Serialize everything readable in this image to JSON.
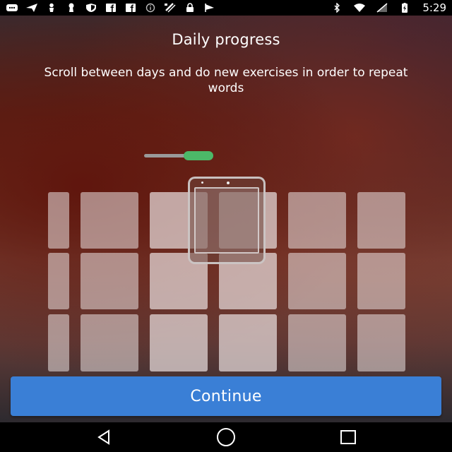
{
  "status_bar": {
    "time": "5:29",
    "left_icons": [
      "message-icon",
      "send-icon",
      "person-icon",
      "keyhole-icon",
      "shield-icon",
      "facebook-icon",
      "facebook-icon",
      "info-icon",
      "satellite-icon",
      "lock-icon",
      "flag-icon"
    ],
    "right_icons": [
      "bluetooth-icon",
      "wifi-icon",
      "signal-icon",
      "battery-charging-icon"
    ]
  },
  "onboarding": {
    "title": "Daily progress",
    "subtitle": "Scroll between days and do new exercises in order to repeat words",
    "continue_label": "Continue"
  },
  "colors": {
    "accent_button": "#3a7fd6",
    "slider_knob": "#4cb868"
  },
  "nav_bar": {
    "buttons": [
      "back-icon",
      "home-icon",
      "recents-icon"
    ]
  }
}
